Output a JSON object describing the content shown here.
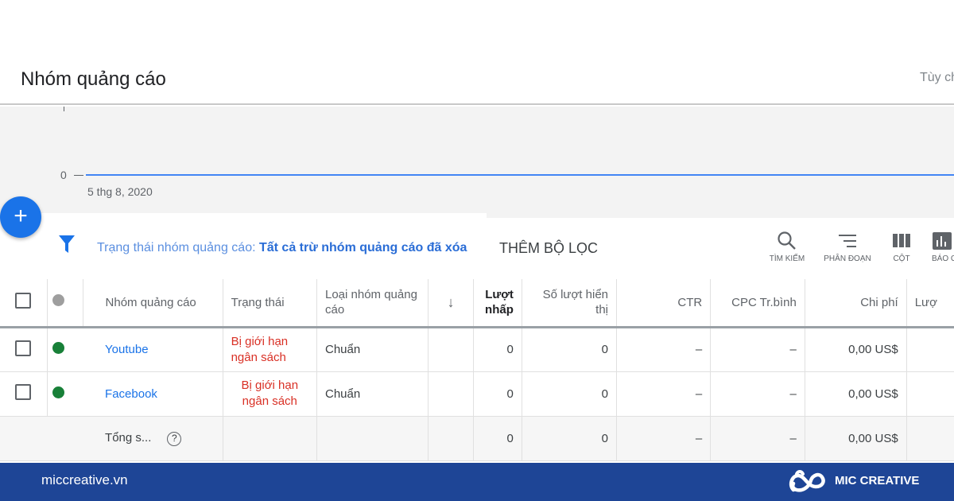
{
  "header": {
    "title": "Nhóm quảng cáo",
    "custom_label": "Tùy ch"
  },
  "chart": {
    "y_tick": "0",
    "x_tick": "5 thg 8, 2020",
    "line_color": "#4285f4"
  },
  "filter": {
    "label": "Trạng thái nhóm quảng cáo: ",
    "value": "Tất cả trừ nhóm quảng cáo đã xóa",
    "add_filter": "THÊM BỘ LỌC"
  },
  "tools": [
    {
      "label": "TÌM KIẾM",
      "icon": "search-icon"
    },
    {
      "label": "PHÂN ĐOẠN",
      "icon": "segment-icon"
    },
    {
      "label": "CỘT",
      "icon": "columns-icon"
    },
    {
      "label": "BÁO C",
      "icon": "report-icon"
    }
  ],
  "table": {
    "headers": [
      "Nhóm quảng cáo",
      "Trạng thái",
      "Loại nhóm quảng cáo",
      "↓",
      "Lượt nhấp",
      "Số lượt hiển thị",
      "CTR",
      "CPC Tr.bình",
      "Chi phí",
      "Lượ"
    ],
    "rows": [
      {
        "name": "Youtube",
        "status": "Bị giới hạn ngân sách",
        "type": "Chuẩn",
        "clicks": "0",
        "impressions": "0",
        "ctr": "–",
        "cpc": "–",
        "cost": "0,00 US$",
        "status_color": "#188038"
      },
      {
        "name": "Facebook",
        "status": "Bị giới hạn ngân sách",
        "type": "Chuẩn",
        "clicks": "0",
        "impressions": "0",
        "ctr": "–",
        "cpc": "–",
        "cost": "0,00 US$",
        "status_color": "#188038"
      }
    ],
    "total": {
      "label": "Tổng s...",
      "clicks": "0",
      "impressions": "0",
      "ctr": "–",
      "cpc": "–",
      "cost": "0,00 US$"
    }
  },
  "footer": {
    "site": "miccreative.vn",
    "brand": "MIC CREATIVE",
    "bg": "#1e4596"
  }
}
